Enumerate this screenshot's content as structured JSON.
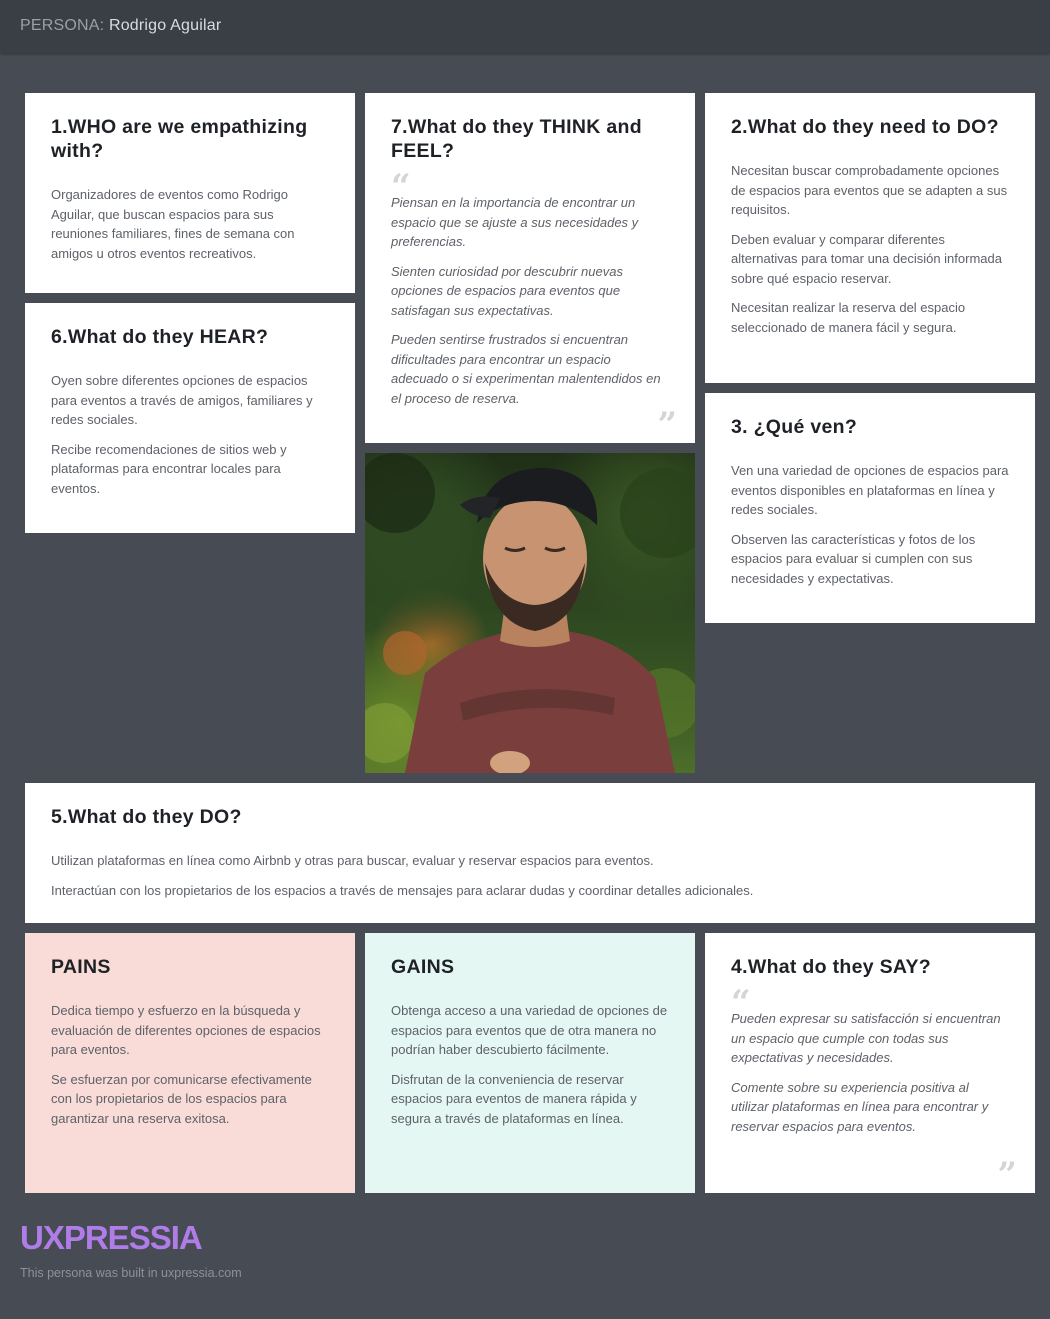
{
  "header": {
    "prefix": "PERSONA:",
    "name": "Rodrigo Aguilar"
  },
  "cards": {
    "who": {
      "title": "1.WHO are we empathizing with?",
      "paragraphs": [
        "Organizadores de eventos como Rodrigo Aguilar, que buscan espacios para sus reuniones familiares, fines de semana con amigos u otros eventos recreativos."
      ]
    },
    "think_feel": {
      "title": "7.What do they THINK and FEEL?",
      "paragraphs": [
        "Piensan en la importancia de encontrar un espacio que se ajuste a sus necesidades y preferencias.",
        "Sienten curiosidad por descubrir nuevas opciones de espacios para eventos que satisfagan sus expectativas.",
        "Pueden sentirse frustrados si encuentran dificultades para encontrar un espacio adecuado o si experimentan malentendidos en el proceso de reserva."
      ]
    },
    "need_do": {
      "title": "2.What do they need to DO?",
      "paragraphs": [
        "Necesitan buscar comprobadamente opciones de espacios para eventos que se adapten a sus requisitos.",
        "Deben evaluar y comparar diferentes alternativas para tomar una decisión informada sobre qué espacio reservar.",
        "Necesitan realizar la reserva del espacio seleccionado de manera fácil y segura."
      ]
    },
    "hear": {
      "title": "6.What do they HEAR?",
      "paragraphs": [
        "Oyen sobre diferentes opciones de espacios para eventos a través de amigos, familiares y redes sociales.",
        "Recibe recomendaciones de sitios web y plataformas para encontrar locales para eventos."
      ]
    },
    "see": {
      "title": "3. ¿Qué ven?",
      "paragraphs": [
        "Ven una variedad de opciones de espacios para eventos disponibles en plataformas en línea y redes sociales.",
        "Observen las características y fotos de los espacios para evaluar si cumplen con sus necesidades y expectativas."
      ]
    },
    "do": {
      "title": "5.What do they DO?",
      "paragraphs": [
        "Utilizan plataformas en línea como Airbnb y otras para buscar, evaluar y reservar espacios para eventos.",
        "Interactúan con los propietarios de los espacios a través de mensajes para aclarar dudas y coordinar detalles adicionales."
      ]
    },
    "pains": {
      "title": "PAINS",
      "paragraphs": [
        "Dedica tiempo y esfuerzo en la búsqueda y evaluación de diferentes opciones de espacios para eventos.",
        "Se esfuerzan por comunicarse efectivamente con los propietarios de los espacios para garantizar una reserva exitosa."
      ]
    },
    "gains": {
      "title": "GAINS",
      "paragraphs": [
        "Obtenga acceso a una variedad de opciones de espacios para eventos que de otra manera no podrían haber descubierto fácilmente.",
        "Disfrutan de la conveniencia de reservar espacios para eventos de manera rápida y segura a través de plataformas en línea."
      ]
    },
    "say": {
      "title": "4.What do they SAY?",
      "paragraphs": [
        "Pueden expresar su satisfacción si encuentran un espacio que cumple con todas sus expectativas y necesidades.",
        "Comente sobre su experiencia positiva al utilizar plataformas en línea para encontrar y reservar espacios para eventos."
      ]
    }
  },
  "footer": {
    "logo": "UXPRESSIA",
    "note": "This persona was built in uxpressia.com"
  },
  "colors": {
    "background": "#474c54",
    "topbar": "#3a3e45",
    "pains": "#f9dcd8",
    "gains": "#e5f7f3",
    "logo": "#b07ce8"
  }
}
